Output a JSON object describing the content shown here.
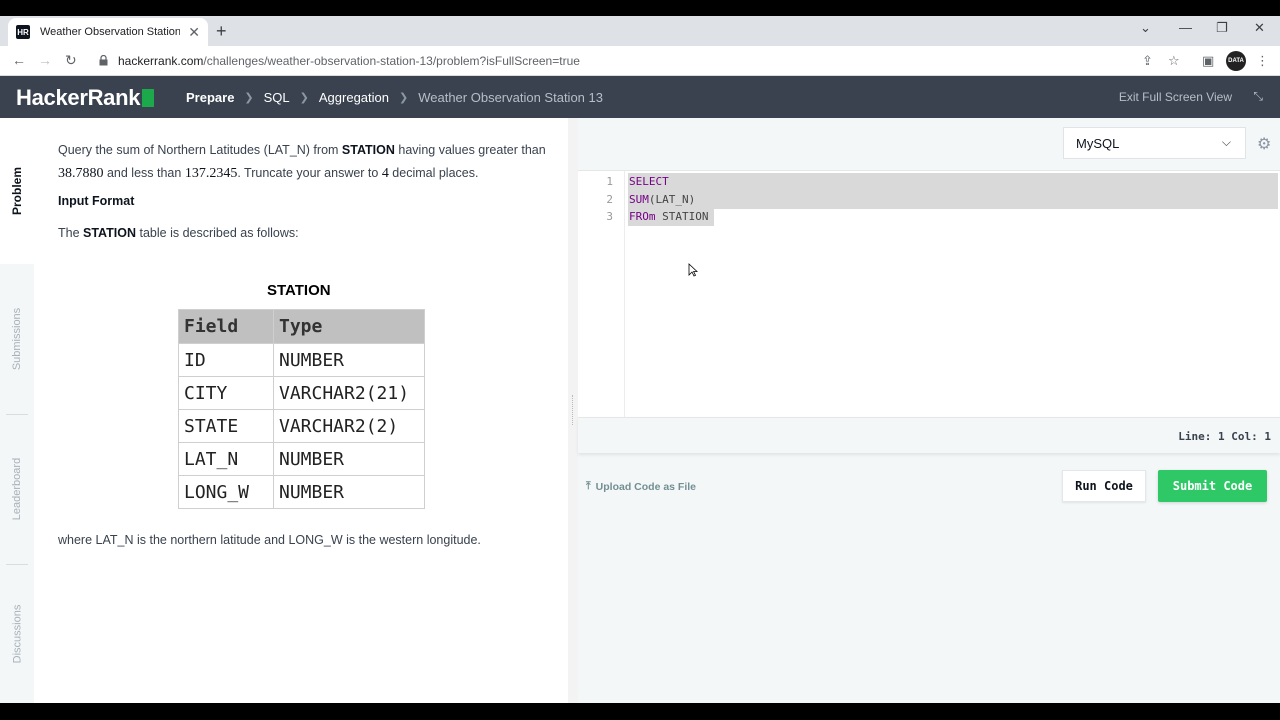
{
  "browser": {
    "tab_title": "Weather Observation Station 13",
    "favicon_text": "HR",
    "url_domain": "hackerrank.com",
    "url_path": "/challenges/weather-observation-station-13/problem?isFullScreen=true",
    "profile_text": "DATA"
  },
  "header": {
    "logo": "HackerRank",
    "crumbs": [
      "Prepare",
      "SQL",
      "Aggregation",
      "Weather Observation Station 13"
    ],
    "exit_fullscreen": "Exit Full Screen View"
  },
  "sidebar": {
    "tabs": [
      "Problem",
      "Submissions",
      "Leaderboard",
      "Discussions"
    ]
  },
  "problem": {
    "p1_a": "Query the sum of Northern Latitudes (LAT_N) from ",
    "p1_station": "STATION",
    "p1_b": " having values greater than ",
    "num1": "38.7880",
    "p1_c": " and less than ",
    "num2": "137.2345",
    "p1_d": ". Truncate your answer to ",
    "num3": "4",
    "p1_e": " decimal places.",
    "input_format": "Input Format",
    "desc_a": "The ",
    "desc_station": "STATION",
    "desc_b": " table is described as follows:",
    "where": "where LAT_N is the northern latitude and LONG_W is the western longitude."
  },
  "station_table": {
    "title": "STATION",
    "headers": [
      "Field",
      "Type"
    ],
    "rows": [
      [
        "ID",
        "NUMBER"
      ],
      [
        "CITY",
        "VARCHAR2(21)"
      ],
      [
        "STATE",
        "VARCHAR2(2)"
      ],
      [
        "LAT_N",
        "NUMBER"
      ],
      [
        "LONG_W",
        "NUMBER"
      ]
    ]
  },
  "editor": {
    "language": "MySQL",
    "line_numbers": [
      "1",
      "2",
      "3"
    ],
    "code": {
      "l1_kw": "SELECT",
      "l2_fn": "SUM",
      "l2_rest": "(LAT_N)",
      "l3_kw": "FROm",
      "l3_rest": " STATION"
    },
    "status": "Line: 1 Col: 1"
  },
  "actions": {
    "upload": "Upload Code as File",
    "run": "Run Code",
    "submit": "Submit Code"
  },
  "colors": {
    "brand_green": "#1ba94c",
    "submit_green": "#2ec866",
    "header_bg": "#39424e"
  }
}
